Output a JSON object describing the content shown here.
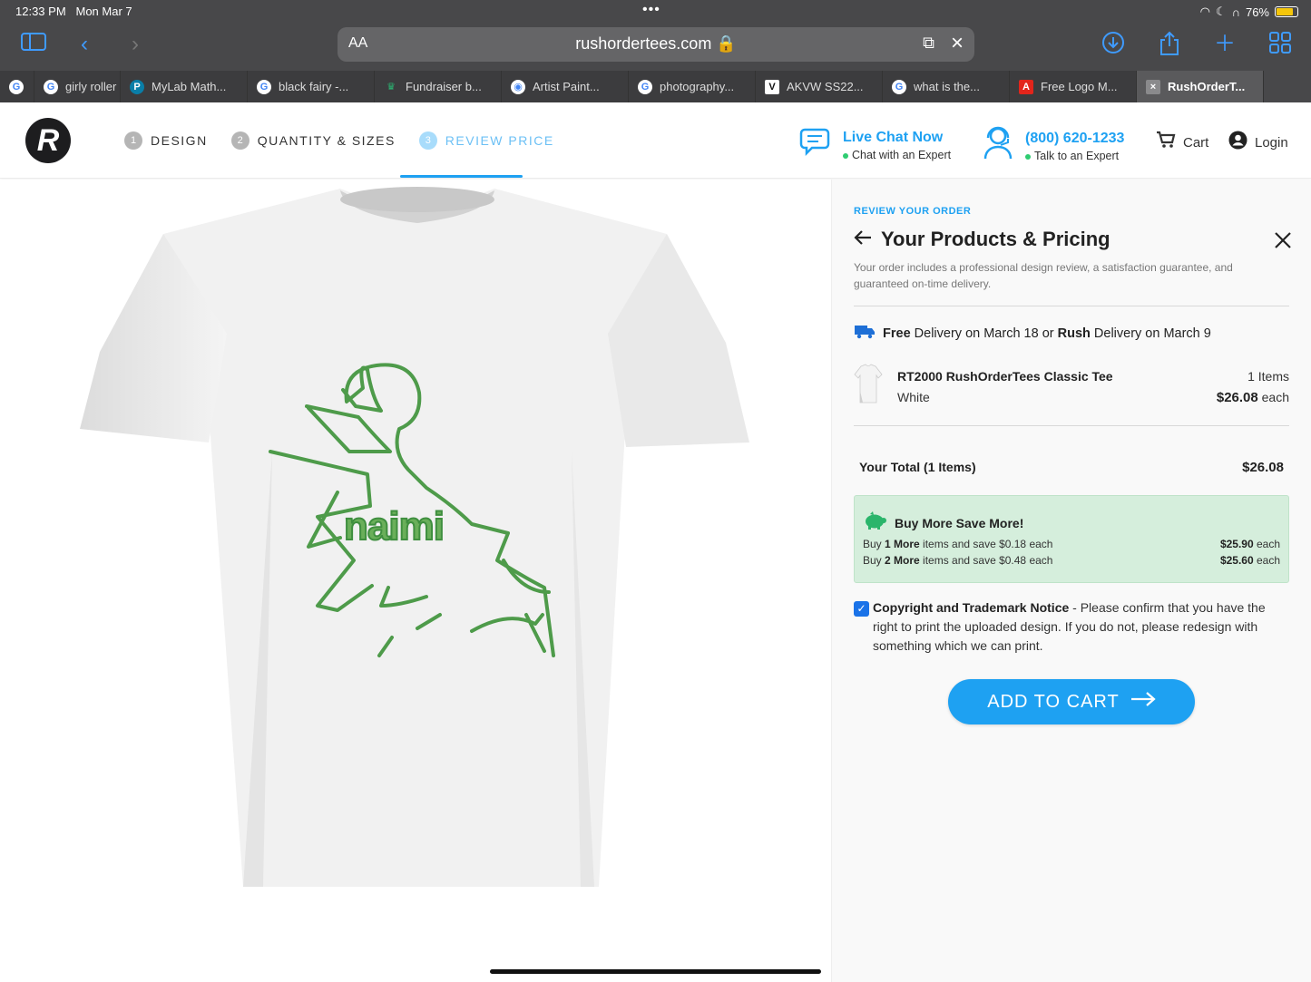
{
  "status": {
    "time": "12:33 PM",
    "date": "Mon Mar 7",
    "battery": "76%",
    "battery_level": 0.76
  },
  "browser": {
    "aa_label": "AA",
    "url": "rushordertees.com",
    "tabs": [
      {
        "label": "",
        "icon": "google"
      },
      {
        "label": "girly roller s",
        "icon": "google"
      },
      {
        "label": "MyLab Math...",
        "icon": "pearson"
      },
      {
        "label": "black fairy -...",
        "icon": "google"
      },
      {
        "label": "Fundraiser b...",
        "icon": "crown"
      },
      {
        "label": "Artist Paint...",
        "icon": "color-wheel"
      },
      {
        "label": "photography...",
        "icon": "google"
      },
      {
        "label": "AKVW SS22...",
        "icon": "v-logo"
      },
      {
        "label": "what is the...",
        "icon": "google"
      },
      {
        "label": "Free Logo M...",
        "icon": "adobe"
      },
      {
        "label": "RushOrderT...",
        "icon": "close",
        "active": true
      }
    ]
  },
  "header": {
    "logo": "R",
    "steps": [
      {
        "num": "1",
        "label": "DESIGN"
      },
      {
        "num": "2",
        "label": "QUANTITY & SIZES"
      },
      {
        "num": "3",
        "label": "REVIEW PRICE",
        "active": true
      }
    ],
    "chat": {
      "title": "Live Chat Now",
      "subtitle": "Chat with an Expert"
    },
    "phone": {
      "title": "(800) 620-1233",
      "subtitle": "Talk to an Expert"
    },
    "cart_label": "Cart",
    "login_label": "Login"
  },
  "design": {
    "text": "naimi",
    "accent": "#4e9b4a"
  },
  "panel": {
    "review_label": "REVIEW YOUR ORDER",
    "title": "Your Products & Pricing",
    "subtitle": "Your order includes a professional design review, a satisfaction guarantee, and guaranteed on-time delivery.",
    "delivery": {
      "free": "Free",
      "mid1": " Delivery on March 18 or ",
      "rush": "Rush",
      "mid2": " Delivery on March 9"
    },
    "item": {
      "name": "RT2000 RushOrderTees Classic Tee",
      "color": "White",
      "qty": "1 Items",
      "price": "$26.08",
      "each": " each"
    },
    "total": {
      "label": "Your Total (1 Items)",
      "amount": "$26.08"
    },
    "promo": {
      "title": "Buy More Save More!",
      "rows": [
        {
          "pre": "Buy ",
          "bold": "1 More",
          "post": " items and save $0.18 each",
          "price": "$25.90",
          "each": " each"
        },
        {
          "pre": "Buy ",
          "bold": "2 More",
          "post": " items and save $0.48 each",
          "price": "$25.60",
          "each": " each"
        }
      ]
    },
    "notice": {
      "bold": "Copyright and Trademark Notice",
      "text": " - Please confirm that you have the right to print the uploaded design. If you do not, please redesign with something which we can print."
    },
    "cta": "ADD TO CART"
  },
  "colors": {
    "accent": "#1ea1f2",
    "promo_bg": "#d5eedc",
    "checkbox": "#1a73e8"
  }
}
